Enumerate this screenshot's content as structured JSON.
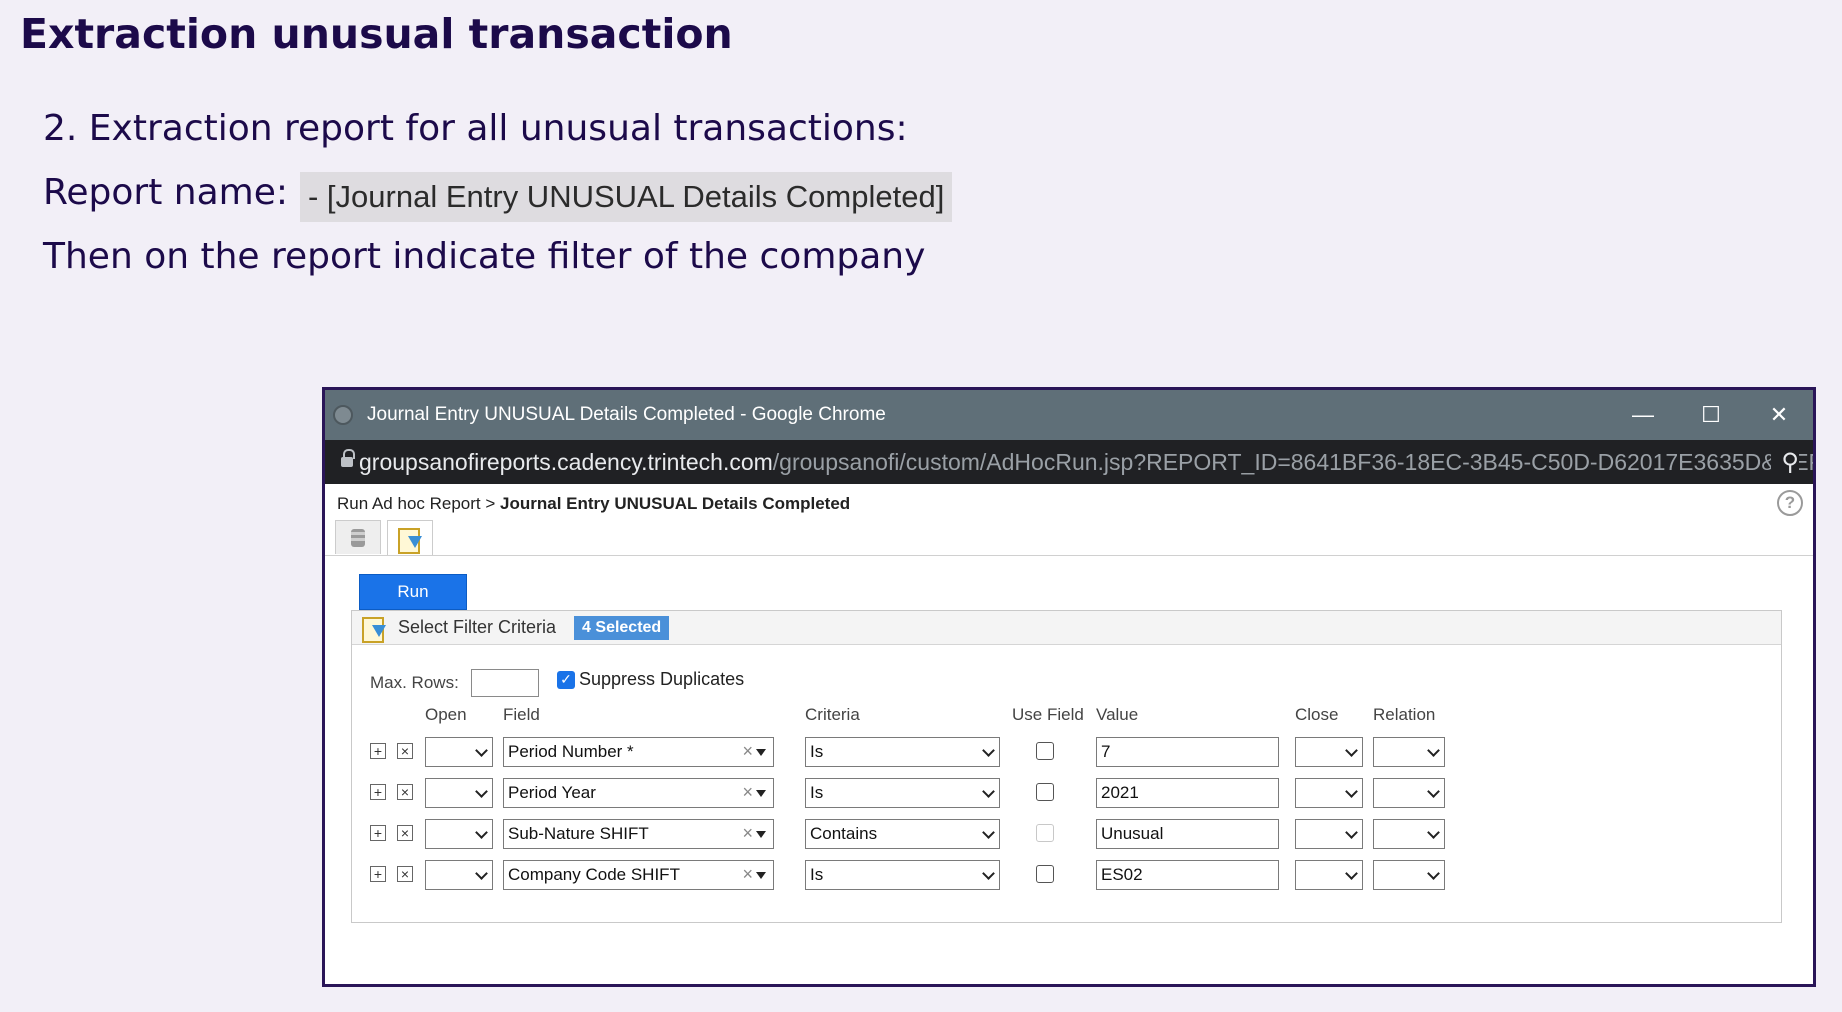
{
  "slide": {
    "title": "Extraction unusual transaction",
    "line1": "2. Extraction report for all unusual transactions:",
    "line2_label": "Report name:",
    "report_name": "- [Journal Entry UNUSUAL Details Completed]",
    "line3": "Then on the report indicate filter of the company"
  },
  "window": {
    "title": "Journal Entry UNUSUAL Details Completed - Google Chrome",
    "url_host": "groupsanofireports.cadency.trintech.com",
    "url_path": "/groupsanofi/custom/AdHocRun.jsp?REPORT_ID=8641BF36-18EC-3B45-C50D-D62017E3635D&REPORT_S...",
    "minimize": "—",
    "maximize": "☐",
    "close": "✕",
    "zoom": "⚲"
  },
  "breadcrumb": {
    "parent": "Run Ad hoc Report >",
    "current": "Journal Entry UNUSUAL Details Completed"
  },
  "help": "?",
  "run_label": "Run",
  "panel": {
    "header": "Select Filter Criteria",
    "badge": "4 Selected",
    "max_rows_label": "Max. Rows:",
    "max_rows_value": "",
    "suppress_label": "Suppress Duplicates",
    "suppress_checked": true
  },
  "columns": {
    "open": "Open",
    "field": "Field",
    "criteria": "Criteria",
    "use_field": "Use Field",
    "value": "Value",
    "close": "Close",
    "relation": "Relation"
  },
  "filters": [
    {
      "open": "",
      "field": "Period Number *",
      "criteria": "Is",
      "use_field": false,
      "use_field_disabled": false,
      "value": "7",
      "close": "",
      "relation": ""
    },
    {
      "open": "",
      "field": "Period Year",
      "criteria": "Is",
      "use_field": false,
      "use_field_disabled": false,
      "value": "2021",
      "close": "",
      "relation": ""
    },
    {
      "open": "",
      "field": "Sub-Nature SHIFT",
      "criteria": "Contains",
      "use_field": false,
      "use_field_disabled": true,
      "value": "Unusual",
      "close": "",
      "relation": ""
    },
    {
      "open": "",
      "field": "Company Code SHIFT",
      "criteria": "Is",
      "use_field": false,
      "use_field_disabled": false,
      "value": "ES02",
      "close": "",
      "relation": ""
    }
  ],
  "icons": {
    "add": "plus-box-icon",
    "remove": "x-box-icon",
    "tab1": "database-icon",
    "tab2": "filter-report-icon"
  }
}
